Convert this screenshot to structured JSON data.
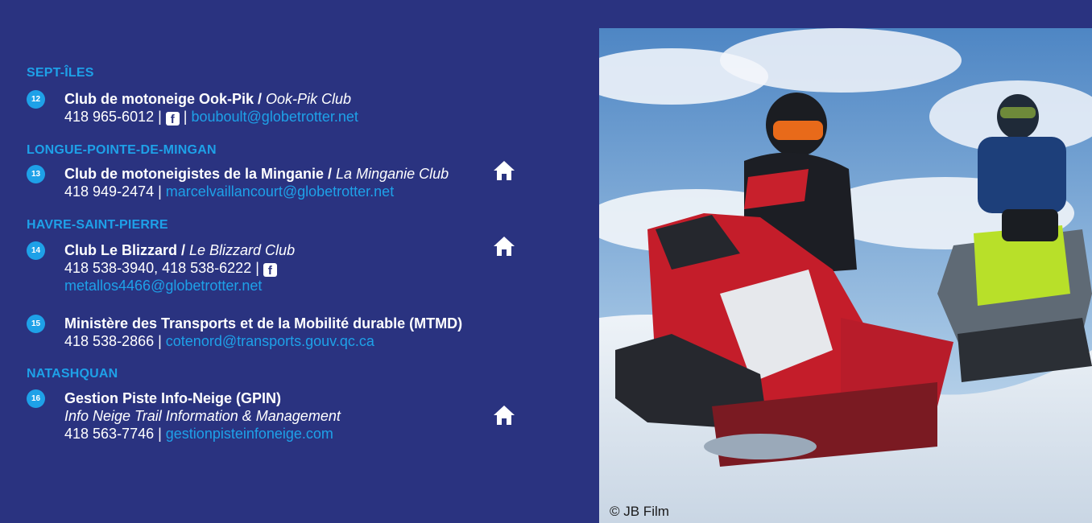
{
  "regions": {
    "sept_iles": "SEPT-ÎLES",
    "longue_pointe": "LONGUE-POINTE-DE-MINGAN",
    "havre": "HAVRE-SAINT-PIERRE",
    "natashquan": "NATASHQUAN"
  },
  "entries": [
    {
      "num": "12",
      "name_fr": "Club de motoneige Ook-Pik / ",
      "name_en": "Ook-Pik Club",
      "phone": "418 965-6012 | ",
      "sep": " | ",
      "email": "bouboult@globetrotter.net"
    },
    {
      "num": "13",
      "name_fr": "Club de motoneigistes de la Minganie / ",
      "name_en": "La Minganie Club",
      "phone": "418 949-2474 | ",
      "email": "marcelvaillancourt@globetrotter.net"
    },
    {
      "num": "14",
      "name_fr": "Club Le Blizzard / ",
      "name_en": "Le Blizzard Club",
      "phone": "418 538-3940, 418 538-6222 | ",
      "email": "metallos4466@globetrotter.net"
    },
    {
      "num": "15",
      "name_fr": "Ministère des Transports et de la Mobilité durable (MTMD)",
      "phone": "418 538-2866 | ",
      "email": "cotenord@transports.gouv.qc.ca"
    },
    {
      "num": "16",
      "name_fr": "Gestion Piste Info-Neige (GPIN)",
      "name_en": "Info Neige Trail Information & Management",
      "phone": "418 563-7746 | ",
      "email": "gestionpisteinfoneige.com"
    }
  ],
  "icons": {
    "facebook": "facebook-icon",
    "home": "home-icon"
  },
  "photo": {
    "credit": "© JB Film"
  },
  "colors": {
    "background": "#2a3380",
    "accent": "#1ea1e8",
    "text": "#ffffff"
  }
}
